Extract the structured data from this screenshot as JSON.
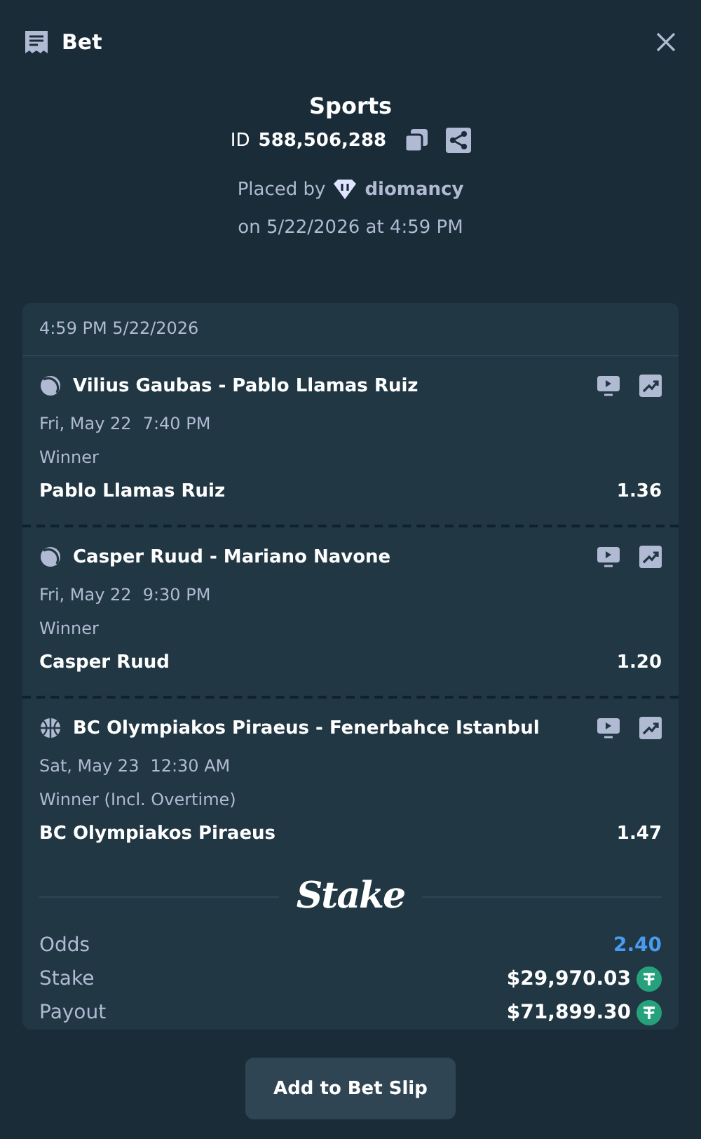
{
  "header": {
    "title": "Bet"
  },
  "summary": {
    "category": "Sports",
    "id_label": "ID",
    "id_value": "588,506,288",
    "placed_by_label": "Placed by",
    "user": "diomancy",
    "placed_on": "on 5/22/2026 at 4:59 PM"
  },
  "slip": {
    "timestamp": "4:59 PM 5/22/2026",
    "legs": [
      {
        "kind": "tennis",
        "event": "Vilius Gaubas - Pablo Llamas Ruiz",
        "date": "Fri, May 22",
        "time": "7:40 PM",
        "market": "Winner",
        "selection": "Pablo Llamas Ruiz",
        "odds": "1.36"
      },
      {
        "kind": "tennis",
        "event": "Casper Ruud - Mariano Navone",
        "date": "Fri, May 22",
        "time": "9:30 PM",
        "market": "Winner",
        "selection": "Casper Ruud",
        "odds": "1.20"
      },
      {
        "kind": "basketball",
        "event": "BC Olympiakos Piraeus - Fenerbahce Istanbul",
        "date": "Sat, May 23",
        "time": "12:30 AM",
        "market": "Winner (Incl. Overtime)",
        "selection": "BC Olympiakos Piraeus",
        "odds": "1.47"
      }
    ],
    "brand": "Stake",
    "totals": [
      {
        "kind": "odds",
        "label": "Odds",
        "value": "2.40"
      },
      {
        "kind": "money",
        "label": "Stake",
        "value": "$29,970.03"
      },
      {
        "kind": "money",
        "label": "Payout",
        "value": "$71,899.30"
      }
    ]
  },
  "action": {
    "label": "Add to Bet Slip"
  }
}
